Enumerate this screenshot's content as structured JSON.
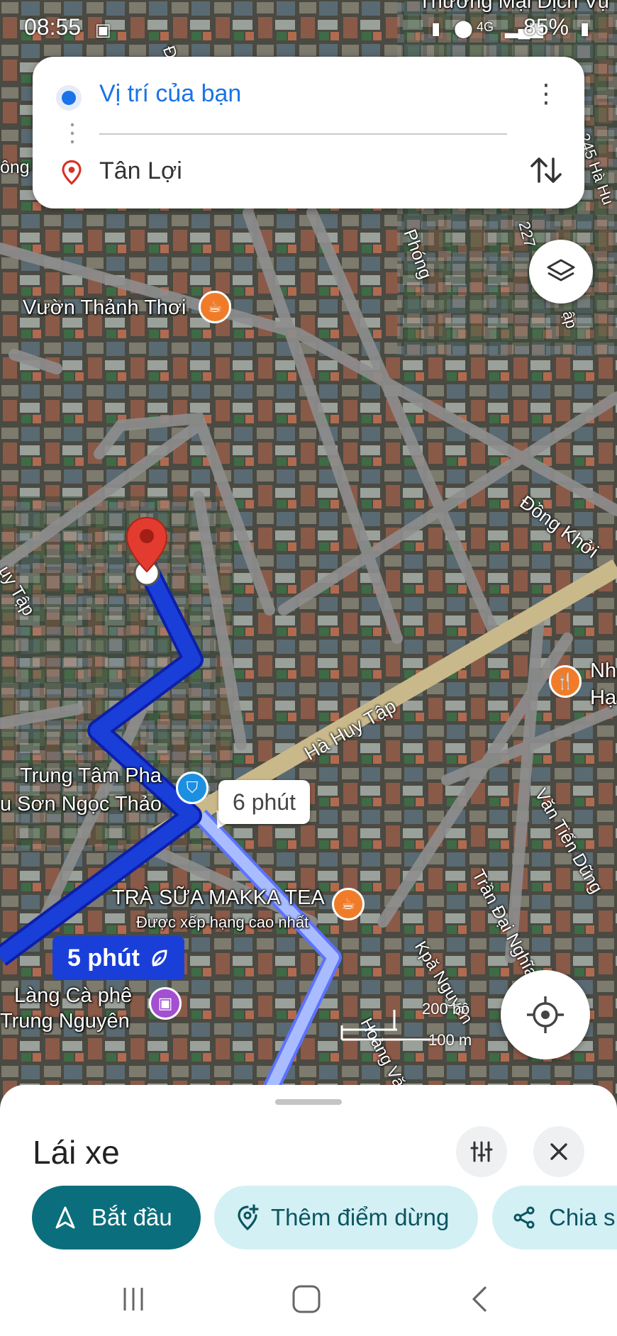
{
  "status_bar": {
    "time": "08:55",
    "battery": "85%",
    "network": "4G"
  },
  "directions": {
    "origin": "Vị trí của bạn",
    "destination": "Tân Lợi",
    "more_icon": "more-vert-icon",
    "swap_icon": "swap-vert-icon"
  },
  "map": {
    "places": {
      "vuon_thanh_thoi": "Vườn Thảnh Thơi",
      "trung_tam_pha_1": "Trung Tâm Pha",
      "trung_tam_pha_2": "u Sơn Ngọc Thảo",
      "tra_sua": "TRÀ SỮA MAKKA TEA",
      "tra_sua_sub": "Được xếp hạng cao nhất",
      "lang_ca_phe_1": "Làng Cà phê",
      "lang_ca_phe_2": "Trung Nguyên",
      "nh_1": "Nh",
      "nh_2": "Hạ",
      "top_partial": "Thương Mại Dịch Vụ"
    },
    "streets": {
      "ha_huy_tap": "Hà Huy Tập",
      "dong_khoi": "Đồng Khởi",
      "van_tien_dung": "Văn Tiến Dũng",
      "tran_dai_nghia": "Trần Đại Nghĩa",
      "kpa_nguyen": "Kpă Nguyên",
      "hoang_van": "Hoàng Văn",
      "phong": "Phóng",
      "ong": "ông",
      "huy_tap_left": "uy Tập",
      "d_top": "Đ.",
      "n245": "245 Hà Hu",
      "n227": "227",
      "ap": "ập"
    },
    "route_primary_time": "5 phút",
    "route_alt_time": "6 phút",
    "scale_feet": "200 bộ",
    "scale_meters": "100 m",
    "route_color": "#1a3fd8",
    "alt_route_color": "#a9bcff"
  },
  "sheet": {
    "mode": "Lái xe",
    "start": "Bắt đầu",
    "add_stop": "Thêm điểm dừng",
    "share": "Chia s",
    "accent": "#0b6e7c"
  }
}
